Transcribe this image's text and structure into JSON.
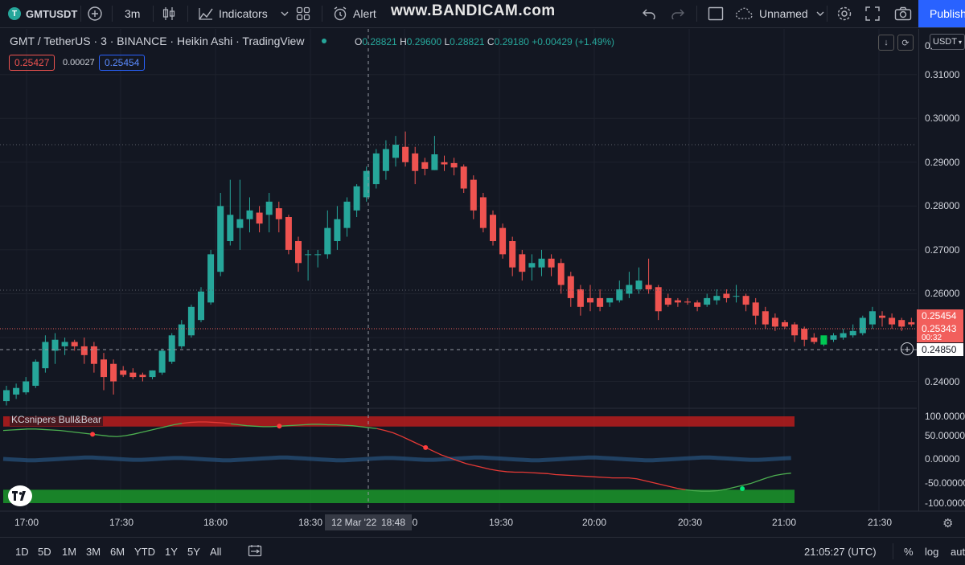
{
  "toolbar": {
    "symbol": "GMTUSDT",
    "add_symbol_icon": "plus-circle-icon",
    "interval": "3m",
    "chart_type_icon": "candles-icon",
    "indicators_label": "Indicators",
    "templates_icon": "grid-icon",
    "alert_label": "Alert",
    "watermark": "www.BANDICAM.com",
    "layout_name": "Unnamed",
    "publish_label": "Publish"
  },
  "legend": {
    "title": "GMT / TetherUS · 3 · BINANCE · Heikin Ashi · TradingView",
    "o_key": "O",
    "o_val": "0.28821",
    "h_key": "H",
    "h_val": "0.29600",
    "l_key": "L",
    "l_val": "0.28821",
    "c_key": "C",
    "c_val": "0.29180 +0.00429 (+1.49%)",
    "sell_price": "0.25427",
    "spread": "0.00027",
    "buy_price": "0.25454"
  },
  "price_axis": {
    "currency": "USDT",
    "top_clip": "0.",
    "labels": [
      "0.31000",
      "0.30000",
      "0.29000",
      "0.28000",
      "0.27000",
      "0.26000",
      "0.24000"
    ],
    "tag_upper": "0.25454",
    "tag_lower": "0.25343",
    "countdown": "00:32",
    "crosshair_price": "0.24850"
  },
  "osc_axis": {
    "labels": [
      "100.00000",
      "50.00000",
      "0.00000",
      "-50.00000",
      "-100.0000"
    ]
  },
  "indicator": {
    "name": "KCsnipers Bull&Bear"
  },
  "time_axis": {
    "labels": [
      "17:00",
      "17:30",
      "18:00",
      "18:30",
      "00",
      "19:30",
      "20:00",
      "20:30",
      "21:00",
      "21:30"
    ],
    "cursor_date": "12 Mar '22",
    "cursor_time": "18:48"
  },
  "bottom": {
    "ranges": [
      "1D",
      "5D",
      "1M",
      "3M",
      "6M",
      "YTD",
      "1Y",
      "5Y",
      "All"
    ],
    "clock": "21:05:27 (UTC)",
    "pct": "%",
    "log": "log",
    "auto": "aut"
  },
  "chart_data": {
    "type": "candlestick",
    "style": "Heikin Ashi",
    "symbol": "GMT / TetherUS",
    "ylim": [
      0.2335,
      0.316
    ],
    "bull_color": "#26a69a",
    "bear_color": "#ef5350",
    "candles": [
      {
        "o": 0.2355,
        "h": 0.239,
        "l": 0.2345,
        "c": 0.238
      },
      {
        "o": 0.237,
        "h": 0.2395,
        "l": 0.236,
        "c": 0.2385
      },
      {
        "o": 0.2375,
        "h": 0.241,
        "l": 0.237,
        "c": 0.24
      },
      {
        "o": 0.239,
        "h": 0.245,
        "l": 0.2385,
        "c": 0.2445
      },
      {
        "o": 0.243,
        "h": 0.2505,
        "l": 0.242,
        "c": 0.249
      },
      {
        "o": 0.247,
        "h": 0.251,
        "l": 0.244,
        "c": 0.2495
      },
      {
        "o": 0.248,
        "h": 0.25,
        "l": 0.246,
        "c": 0.249
      },
      {
        "o": 0.249,
        "h": 0.2495,
        "l": 0.247,
        "c": 0.248
      },
      {
        "o": 0.248,
        "h": 0.25,
        "l": 0.244,
        "c": 0.246
      },
      {
        "o": 0.248,
        "h": 0.249,
        "l": 0.242,
        "c": 0.244
      },
      {
        "o": 0.245,
        "h": 0.2465,
        "l": 0.238,
        "c": 0.241
      },
      {
        "o": 0.244,
        "h": 0.245,
        "l": 0.237,
        "c": 0.24
      },
      {
        "o": 0.2425,
        "h": 0.2435,
        "l": 0.241,
        "c": 0.2415
      },
      {
        "o": 0.242,
        "h": 0.243,
        "l": 0.2405,
        "c": 0.241
      },
      {
        "o": 0.2415,
        "h": 0.242,
        "l": 0.24,
        "c": 0.241
      },
      {
        "o": 0.241,
        "h": 0.2425,
        "l": 0.2405,
        "c": 0.2425
      },
      {
        "o": 0.242,
        "h": 0.2475,
        "l": 0.2415,
        "c": 0.247
      },
      {
        "o": 0.2445,
        "h": 0.251,
        "l": 0.244,
        "c": 0.2505
      },
      {
        "o": 0.248,
        "h": 0.254,
        "l": 0.2475,
        "c": 0.253
      },
      {
        "o": 0.2505,
        "h": 0.2575,
        "l": 0.25,
        "c": 0.257
      },
      {
        "o": 0.254,
        "h": 0.2615,
        "l": 0.2535,
        "c": 0.2605
      },
      {
        "o": 0.258,
        "h": 0.27,
        "l": 0.2575,
        "c": 0.269
      },
      {
        "o": 0.265,
        "h": 0.283,
        "l": 0.264,
        "c": 0.28
      },
      {
        "o": 0.272,
        "h": 0.286,
        "l": 0.271,
        "c": 0.278
      },
      {
        "o": 0.275,
        "h": 0.286,
        "l": 0.27,
        "c": 0.277
      },
      {
        "o": 0.277,
        "h": 0.282,
        "l": 0.274,
        "c": 0.279
      },
      {
        "o": 0.2785,
        "h": 0.28,
        "l": 0.274,
        "c": 0.276
      },
      {
        "o": 0.278,
        "h": 0.283,
        "l": 0.274,
        "c": 0.281
      },
      {
        "o": 0.2795,
        "h": 0.281,
        "l": 0.274,
        "c": 0.277
      },
      {
        "o": 0.2775,
        "h": 0.278,
        "l": 0.269,
        "c": 0.27
      },
      {
        "o": 0.272,
        "h": 0.273,
        "l": 0.265,
        "c": 0.267
      },
      {
        "o": 0.269,
        "h": 0.27,
        "l": 0.263,
        "c": 0.269
      },
      {
        "o": 0.269,
        "h": 0.27,
        "l": 0.266,
        "c": 0.269
      },
      {
        "o": 0.269,
        "h": 0.279,
        "l": 0.268,
        "c": 0.275
      },
      {
        "o": 0.272,
        "h": 0.28,
        "l": 0.27,
        "c": 0.277
      },
      {
        "o": 0.275,
        "h": 0.282,
        "l": 0.273,
        "c": 0.281
      },
      {
        "o": 0.279,
        "h": 0.285,
        "l": 0.2775,
        "c": 0.2845
      },
      {
        "o": 0.282,
        "h": 0.289,
        "l": 0.281,
        "c": 0.288
      },
      {
        "o": 0.285,
        "h": 0.293,
        "l": 0.284,
        "c": 0.292
      },
      {
        "o": 0.288,
        "h": 0.295,
        "l": 0.286,
        "c": 0.293
      },
      {
        "o": 0.291,
        "h": 0.296,
        "l": 0.289,
        "c": 0.294
      },
      {
        "o": 0.2935,
        "h": 0.297,
        "l": 0.289,
        "c": 0.29
      },
      {
        "o": 0.292,
        "h": 0.2935,
        "l": 0.285,
        "c": 0.288
      },
      {
        "o": 0.29,
        "h": 0.291,
        "l": 0.287,
        "c": 0.2885
      },
      {
        "o": 0.2882,
        "h": 0.296,
        "l": 0.2882,
        "c": 0.2918
      },
      {
        "o": 0.29,
        "h": 0.2915,
        "l": 0.288,
        "c": 0.2895
      },
      {
        "o": 0.2898,
        "h": 0.291,
        "l": 0.287,
        "c": 0.2888
      },
      {
        "o": 0.289,
        "h": 0.2895,
        "l": 0.283,
        "c": 0.284
      },
      {
        "o": 0.286,
        "h": 0.287,
        "l": 0.277,
        "c": 0.279
      },
      {
        "o": 0.282,
        "h": 0.283,
        "l": 0.274,
        "c": 0.275
      },
      {
        "o": 0.278,
        "h": 0.279,
        "l": 0.271,
        "c": 0.272
      },
      {
        "o": 0.275,
        "h": 0.276,
        "l": 0.268,
        "c": 0.269
      },
      {
        "o": 0.272,
        "h": 0.273,
        "l": 0.264,
        "c": 0.266
      },
      {
        "o": 0.269,
        "h": 0.27,
        "l": 0.263,
        "c": 0.265
      },
      {
        "o": 0.266,
        "h": 0.269,
        "l": 0.263,
        "c": 0.267
      },
      {
        "o": 0.266,
        "h": 0.27,
        "l": 0.264,
        "c": 0.268
      },
      {
        "o": 0.268,
        "h": 0.269,
        "l": 0.264,
        "c": 0.266
      },
      {
        "o": 0.267,
        "h": 0.268,
        "l": 0.26,
        "c": 0.262
      },
      {
        "o": 0.264,
        "h": 0.265,
        "l": 0.257,
        "c": 0.259
      },
      {
        "o": 0.261,
        "h": 0.262,
        "l": 0.255,
        "c": 0.257
      },
      {
        "o": 0.259,
        "h": 0.262,
        "l": 0.256,
        "c": 0.258
      },
      {
        "o": 0.259,
        "h": 0.261,
        "l": 0.256,
        "c": 0.257
      },
      {
        "o": 0.258,
        "h": 0.259,
        "l": 0.257,
        "c": 0.259
      },
      {
        "o": 0.2585,
        "h": 0.263,
        "l": 0.258,
        "c": 0.261
      },
      {
        "o": 0.26,
        "h": 0.265,
        "l": 0.259,
        "c": 0.262
      },
      {
        "o": 0.261,
        "h": 0.266,
        "l": 0.26,
        "c": 0.263
      },
      {
        "o": 0.262,
        "h": 0.268,
        "l": 0.26,
        "c": 0.261
      },
      {
        "o": 0.2615,
        "h": 0.262,
        "l": 0.254,
        "c": 0.256
      },
      {
        "o": 0.259,
        "h": 0.26,
        "l": 0.257,
        "c": 0.2575
      },
      {
        "o": 0.2585,
        "h": 0.259,
        "l": 0.257,
        "c": 0.258
      },
      {
        "o": 0.2582,
        "h": 0.259,
        "l": 0.2575,
        "c": 0.258
      },
      {
        "o": 0.258,
        "h": 0.2585,
        "l": 0.256,
        "c": 0.257
      },
      {
        "o": 0.2575,
        "h": 0.26,
        "l": 0.257,
        "c": 0.259
      },
      {
        "o": 0.2585,
        "h": 0.261,
        "l": 0.2575,
        "c": 0.2595
      },
      {
        "o": 0.26,
        "h": 0.261,
        "l": 0.258,
        "c": 0.259
      },
      {
        "o": 0.2595,
        "h": 0.262,
        "l": 0.258,
        "c": 0.2595
      },
      {
        "o": 0.2595,
        "h": 0.26,
        "l": 0.256,
        "c": 0.2575
      },
      {
        "o": 0.258,
        "h": 0.259,
        "l": 0.253,
        "c": 0.255
      },
      {
        "o": 0.256,
        "h": 0.257,
        "l": 0.252,
        "c": 0.253
      },
      {
        "o": 0.2545,
        "h": 0.2555,
        "l": 0.2515,
        "c": 0.2525
      },
      {
        "o": 0.2535,
        "h": 0.254,
        "l": 0.252,
        "c": 0.2525
      },
      {
        "o": 0.253,
        "h": 0.2535,
        "l": 0.249,
        "c": 0.2505
      },
      {
        "o": 0.252,
        "h": 0.2525,
        "l": 0.248,
        "c": 0.2495
      },
      {
        "o": 0.25,
        "h": 0.251,
        "l": 0.2485,
        "c": 0.249
      },
      {
        "o": 0.2495,
        "h": 0.25,
        "l": 0.248,
        "c": 0.25
      },
      {
        "o": 0.2495,
        "h": 0.251,
        "l": 0.249,
        "c": 0.2505
      },
      {
        "o": 0.25,
        "h": 0.252,
        "l": 0.2495,
        "c": 0.251
      },
      {
        "o": 0.2505,
        "h": 0.253,
        "l": 0.25,
        "c": 0.2515
      },
      {
        "o": 0.251,
        "h": 0.255,
        "l": 0.2505,
        "c": 0.2545
      },
      {
        "o": 0.253,
        "h": 0.257,
        "l": 0.252,
        "c": 0.256
      },
      {
        "o": 0.255,
        "h": 0.256,
        "l": 0.2525,
        "c": 0.2545
      },
      {
        "o": 0.2545,
        "h": 0.2555,
        "l": 0.252,
        "c": 0.253
      },
      {
        "o": 0.254,
        "h": 0.2545,
        "l": 0.2515,
        "c": 0.2525
      },
      {
        "o": 0.2535,
        "h": 0.2545,
        "l": 0.2525,
        "c": 0.253
      }
    ],
    "oscillator": {
      "ylim": [
        -100,
        100
      ],
      "fast_line": [
        60,
        61,
        62,
        63,
        63,
        62,
        61,
        60,
        58,
        56,
        54,
        52,
        50,
        48,
        47,
        49,
        52,
        56,
        60,
        64,
        68,
        72,
        75,
        77,
        78,
        78,
        77,
        76,
        74,
        72,
        70,
        69,
        68,
        68,
        69,
        70,
        71,
        72,
        73,
        73,
        72,
        72,
        71,
        70,
        68,
        66,
        64,
        60,
        55,
        48,
        40,
        32,
        24,
        16,
        8,
        2,
        -4,
        -10,
        -14,
        -18,
        -22,
        -25,
        -27,
        -28,
        -28,
        -29,
        -30,
        -31,
        -33,
        -34,
        -35,
        -36,
        -37,
        -38,
        -39,
        -40,
        -40,
        -40,
        -42,
        -46,
        -50,
        -54,
        -58,
        -62,
        -65,
        -67,
        -68,
        -68,
        -67,
        -64,
        -60,
        -56,
        -52,
        -46,
        -40,
        -35,
        -32,
        -30,
        -30,
        -31
      ],
      "green_segments": [
        [
          0,
          22
        ],
        [
          28,
          46
        ],
        [
          84,
          97
        ]
      ],
      "red_segments": [
        [
          22,
          28
        ],
        [
          46,
          84
        ]
      ],
      "wave": [
        0,
        -1,
        -2,
        -3,
        -3,
        -2,
        -1,
        0,
        1,
        2,
        3,
        3,
        2,
        1,
        0,
        -1,
        -2,
        -2,
        -1,
        0,
        1,
        2,
        2,
        1,
        0,
        -1,
        -2,
        -3,
        -3,
        -2,
        -1,
        0,
        1,
        2,
        3,
        3,
        2,
        1,
        0,
        -1,
        -2,
        -3,
        -3,
        -2,
        -1,
        0,
        1,
        2,
        2,
        1,
        0,
        -1,
        -2,
        -2,
        -1,
        0,
        1,
        2,
        3,
        3,
        2,
        1,
        0,
        -1,
        -2,
        -3,
        -3,
        -2,
        -1,
        0,
        1,
        2,
        3,
        3,
        2,
        1,
        0,
        -1,
        -2,
        -3,
        -3,
        -2,
        -1,
        0,
        1,
        2,
        3,
        3,
        2,
        1,
        0,
        -1,
        -2,
        -2,
        -1,
        0,
        1,
        2
      ],
      "upper_band": [
        75,
        100
      ],
      "lower_band": [
        -100,
        -65
      ],
      "red_dots_at": [
        11,
        34,
        52
      ],
      "green_dot_at": 91
    }
  }
}
